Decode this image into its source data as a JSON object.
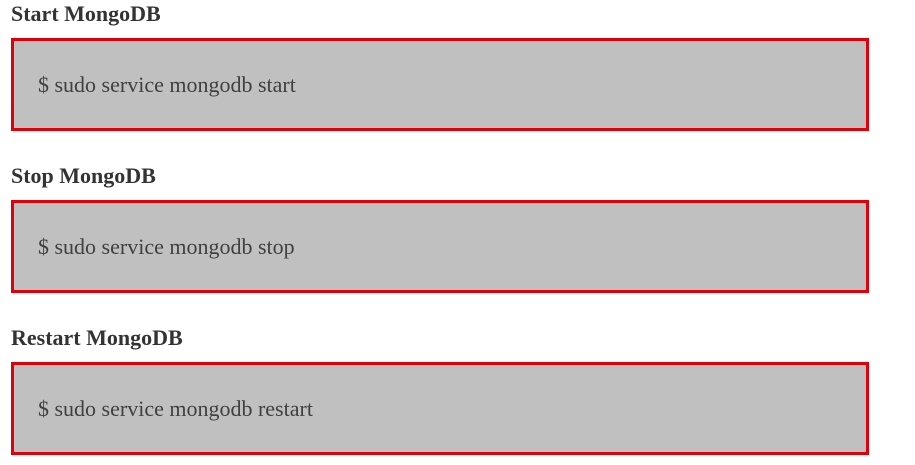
{
  "sections": [
    {
      "heading": "Start MongoDB",
      "command": "$ sudo service mongodb start"
    },
    {
      "heading": "Stop MongoDB",
      "command": "$ sudo service mongodb stop"
    },
    {
      "heading": "Restart MongoDB",
      "command": "$ sudo service mongodb restart"
    }
  ],
  "colors": {
    "box_background": "#c0c0c0",
    "box_border": "#e0000a",
    "heading_text": "#333333",
    "code_text": "#404040"
  }
}
